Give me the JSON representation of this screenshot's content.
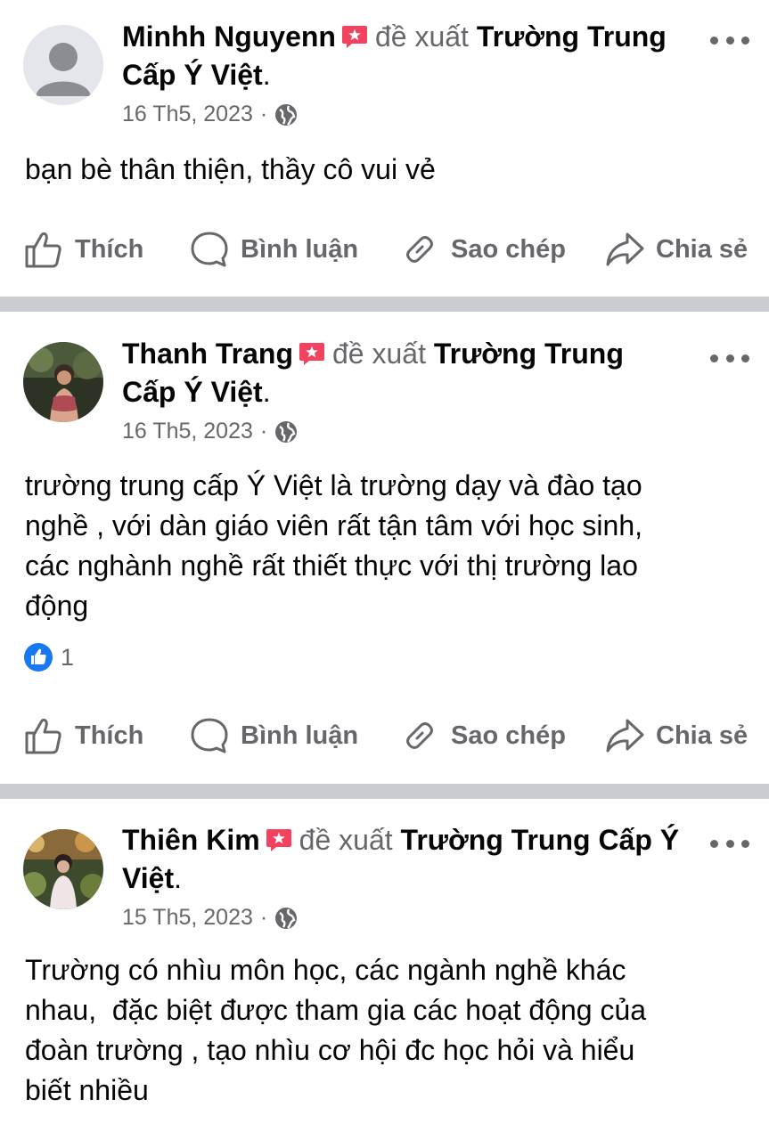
{
  "posts": [
    {
      "author": "Minhh Nguyenn",
      "verb": "đề xuất",
      "page": "Trường Trung Cấp Ý Việt",
      "date": "16 Th5, 2023",
      "text": "bạn bè thân thiện, thầy cô vui vẻ",
      "avatar": "default-avatar",
      "reaction_count": ""
    },
    {
      "author": "Thanh Trang",
      "verb": "đề xuất",
      "page": "Trường Trung Cấp Ý Việt",
      "date": "16 Th5, 2023",
      "text": "trường trung cấp Ý Việt là trường dạy và đào tạo\nnghề , với dàn giáo viên rất tận tâm với học sinh,\ncác nghành nghề rất thiết thực với thị trường lao\nđộng",
      "avatar": "photo-avatar",
      "reaction_count": "1"
    },
    {
      "author": "Thiên Kim",
      "verb": "đề xuất",
      "page": "Trường Trung Cấp Ý Việt",
      "date": "15 Th5, 2023",
      "text": "Trường có nhìu môn học, các ngành nghề khác\nnhau,  đặc biệt được tham gia các hoạt động của\nđoàn trường , tạo nhìu cơ hội đc học hỏi và hiểu\nbiết nhiều",
      "avatar": "photo-avatar",
      "reaction_count": ""
    }
  ],
  "actions": {
    "like": "Thích",
    "comment": "Bình luận",
    "copy": "Sao chép",
    "share": "Chia sẻ"
  },
  "colors": {
    "secondary_text": "#65676b",
    "divider": "#c9ccd1",
    "recommend_badge": "#f3425f",
    "like_blue": "#1877f2"
  }
}
